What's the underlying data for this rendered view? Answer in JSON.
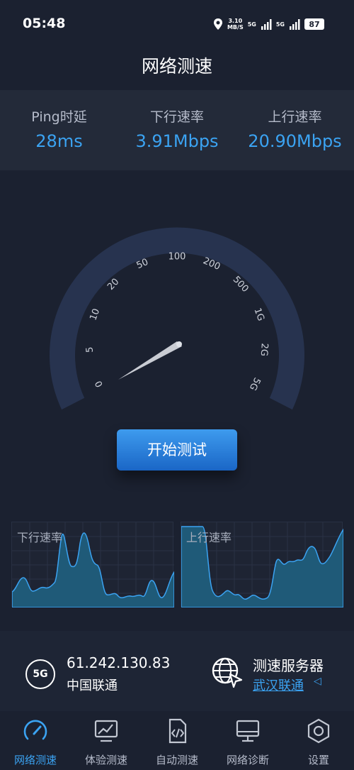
{
  "status": {
    "time": "05:48",
    "speed_value": "3.10",
    "speed_unit": "MB/S",
    "net_a": "5G",
    "net_b": "5G",
    "battery": "87"
  },
  "title": "网络测速",
  "stats": [
    {
      "label": "Ping时延",
      "value": "28ms"
    },
    {
      "label": "下行速率",
      "value": "3.91Mbps"
    },
    {
      "label": "上行速率",
      "value": "20.90Mbps"
    }
  ],
  "gauge": {
    "ticks": [
      "0",
      "5",
      "10",
      "20",
      "50",
      "100",
      "200",
      "500",
      "1G",
      "2G",
      "5G"
    ]
  },
  "start_button": "开始测试",
  "charts": {
    "download_label": "下行速率",
    "upload_label": "上行速率"
  },
  "info": {
    "network_badge": "5G",
    "ip": "61.242.130.83",
    "isp": "中国联通",
    "server_title": "测速服务器",
    "server_name": "武汉联通",
    "server_arrow": "◁"
  },
  "nav": [
    {
      "label": "网络测速",
      "icon": "speedometer-icon",
      "active": true
    },
    {
      "label": "体验测速",
      "icon": "monitor-chart-icon",
      "active": false
    },
    {
      "label": "自动测速",
      "icon": "code-file-icon",
      "active": false
    },
    {
      "label": "网络诊断",
      "icon": "monitor-icon",
      "active": false
    },
    {
      "label": "设置",
      "icon": "settings-icon",
      "active": false
    }
  ],
  "colors": {
    "accent": "#3ba3f2",
    "background": "#1b2130",
    "panel": "#232a39",
    "gauge_track": "#27334f"
  }
}
